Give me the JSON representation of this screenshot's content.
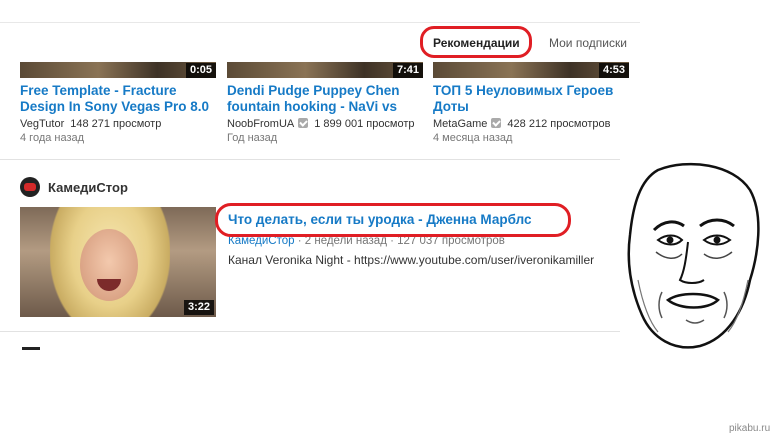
{
  "tabs": {
    "recommended": "Рекомендации",
    "subscriptions": "Мои подписки"
  },
  "videos": [
    {
      "title_line1": "Free Template - Fracture",
      "title_line2": "Design In Sony Vegas Pro 8.0",
      "duration": "0:05",
      "channel": "VegTutor",
      "views": "148 271 просмотр",
      "age": "4 года назад"
    },
    {
      "title_line1": "Dendi Pudge Puppey Chen",
      "title_line2": "fountain hooking - NaVi vs",
      "duration": "7:41",
      "channel": "NoobFromUA",
      "views": "1 899 001 просмотр",
      "age": "Год назад"
    },
    {
      "title_line1": "ТОП 5 Неуловимых Героев",
      "title_line2": "Доты",
      "duration": "4:53",
      "channel": "MetaGame",
      "views": "428 212 просмотров",
      "age": "4 месяца назад"
    }
  ],
  "section": {
    "channel_name": "КамедиСтор",
    "video": {
      "title": "Что делать, если ты уродка - Дженна Марблс",
      "duration": "3:22",
      "channel": "КамедиСтор",
      "age": "2 недели назад",
      "views": "127 037 просмотров",
      "description_prefix": "Канал Veronika Night",
      "description_url": "https://www.youtube.com/user/iveronikamiller"
    }
  },
  "watermark": "pikabu.ru",
  "colors": {
    "link": "#167ac6",
    "highlight_ring": "#e01e24"
  }
}
